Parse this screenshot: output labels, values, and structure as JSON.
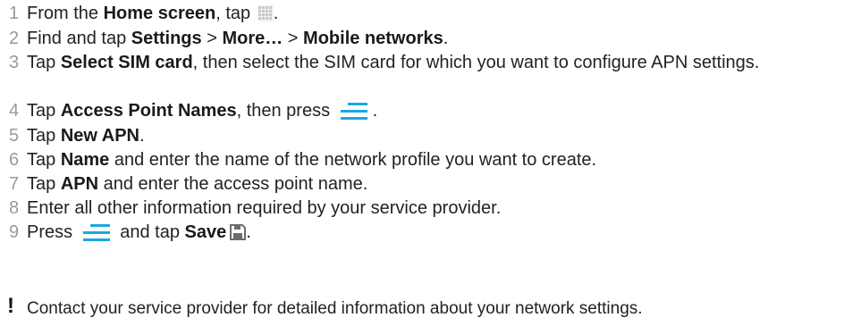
{
  "steps": [
    {
      "num": "1",
      "t1": "From the ",
      "b1": "Home screen",
      "t2": ", tap ",
      "t3": "."
    },
    {
      "num": "2",
      "t1": "Find and tap ",
      "b1": "Settings",
      "t2": " > ",
      "b2": "More…",
      "t3": " > ",
      "b3": "Mobile networks",
      "t4": "."
    },
    {
      "num": "3",
      "t1": "Tap ",
      "b1": "Select SIM card",
      "t2": ", then select the SIM card for which you want to configure APN settings."
    },
    {
      "num": "4",
      "t1": "Tap ",
      "b1": "Access Point Names",
      "t2": ", then press ",
      "t3": "."
    },
    {
      "num": "5",
      "t1": "Tap ",
      "b1": "New APN",
      "t2": "."
    },
    {
      "num": "6",
      "t1": "Tap ",
      "b1": "Name",
      "t2": " and enter the name of the network profile you want to create."
    },
    {
      "num": "7",
      "t1": "Tap ",
      "b1": "APN",
      "t2": " and enter the access point name."
    },
    {
      "num": "8",
      "t1": "Enter all other information required by your service provider."
    },
    {
      "num": "9",
      "t1": "Press ",
      "t2": " and tap ",
      "b1": "Save",
      "t3": "."
    }
  ],
  "note": {
    "mark": "!",
    "text": "Contact your service provider for detailed information about your network settings."
  },
  "icons": {
    "apps": "apps-grid-icon",
    "menu": "menu-icon",
    "save": "save-icon"
  },
  "colors": {
    "accent": "#2fb5b0",
    "menu_icon": "#1aa8e0",
    "step_number": "#9a9a9a"
  }
}
